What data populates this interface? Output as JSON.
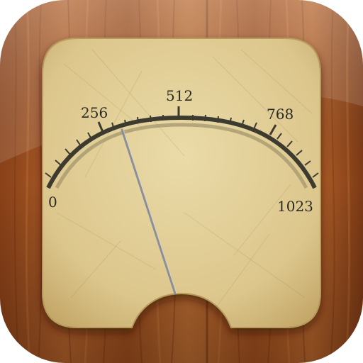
{
  "icon": {
    "name": "analog-meter-app-icon",
    "colors": {
      "wood_dark": "#7a3814",
      "wood_mid": "#a9561f",
      "wood_light": "#c4742f",
      "dial_face": "#e2cf98",
      "dial_face_edge": "#c8ac6c",
      "scale_arc": "#3d3b30",
      "inner_arc": "#a89a70",
      "needle": "#8c8f96"
    }
  },
  "meter": {
    "scale_min": "0",
    "scale_max": "1023",
    "labels": {
      "min": "0",
      "quarter": "256",
      "mid": "512",
      "three_quarter": "768",
      "max": "1023"
    },
    "needle_value": 300
  }
}
